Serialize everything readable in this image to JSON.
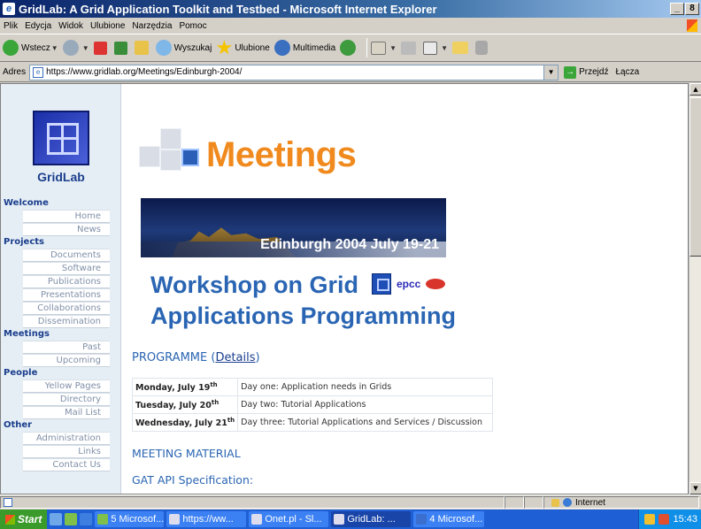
{
  "window": {
    "title": "GridLab: A Grid Application Toolkit and Testbed - Microsoft Internet Explorer",
    "minimize": "_",
    "restore": "8"
  },
  "menu": [
    "Plik",
    "Edycja",
    "Widok",
    "Ulubione",
    "Narzędzia",
    "Pomoc"
  ],
  "toolbar": {
    "back": "Wstecz",
    "search": "Wyszukaj",
    "favorites": "Ulubione",
    "media": "Multimedia"
  },
  "address": {
    "label": "Adres",
    "url": "https://www.gridlab.org/Meetings/Edinburgh-2004/",
    "go": "Przejdź",
    "links": "Łącza"
  },
  "sidebar": {
    "logo_text": "GridLab",
    "sections": [
      {
        "heading": "Welcome",
        "items": [
          "Home",
          "News"
        ]
      },
      {
        "heading": "Projects",
        "items": [
          "Documents",
          "Software",
          "Publications",
          "Presentations",
          "Collaborations",
          "Dissemination"
        ]
      },
      {
        "heading": "Meetings",
        "items": [
          "Past",
          "Upcoming"
        ]
      },
      {
        "heading": "People",
        "items": [
          "Yellow Pages",
          "Directory",
          "Mail List"
        ]
      },
      {
        "heading": "Other",
        "items": [
          "Administration",
          "Links",
          "Contact Us"
        ]
      }
    ]
  },
  "main": {
    "meetings_title": "Meetings",
    "banner_text": "Edinburgh 2004 July 19-21",
    "workshop_line1": "Workshop on Grid",
    "workshop_line2": "Applications Programming",
    "epcc": "epcc",
    "programme_label": "PROGRAMME (",
    "programme_link": "Details",
    "programme_close": ")",
    "schedule": [
      {
        "day": "Monday, July 19",
        "sup": "th",
        "desc": "Day one: Application needs in Grids"
      },
      {
        "day": "Tuesday, July 20",
        "sup": "th",
        "desc": "Day two: Tutorial Applications"
      },
      {
        "day": "Wednesday, July 21",
        "sup": "th",
        "desc": "Day three: Tutorial Applications and Services / Discussion"
      }
    ],
    "material": "MEETING MATERIAL",
    "gat": "GAT API Specification:"
  },
  "status": {
    "zone": "Internet"
  },
  "taskbar": {
    "start": "Start",
    "tasks": [
      "5 Microsof...",
      "https://ww...",
      "Onet.pl - Sl...",
      "GridLab: ...",
      "4 Microsof..."
    ],
    "clock": "15:43"
  }
}
